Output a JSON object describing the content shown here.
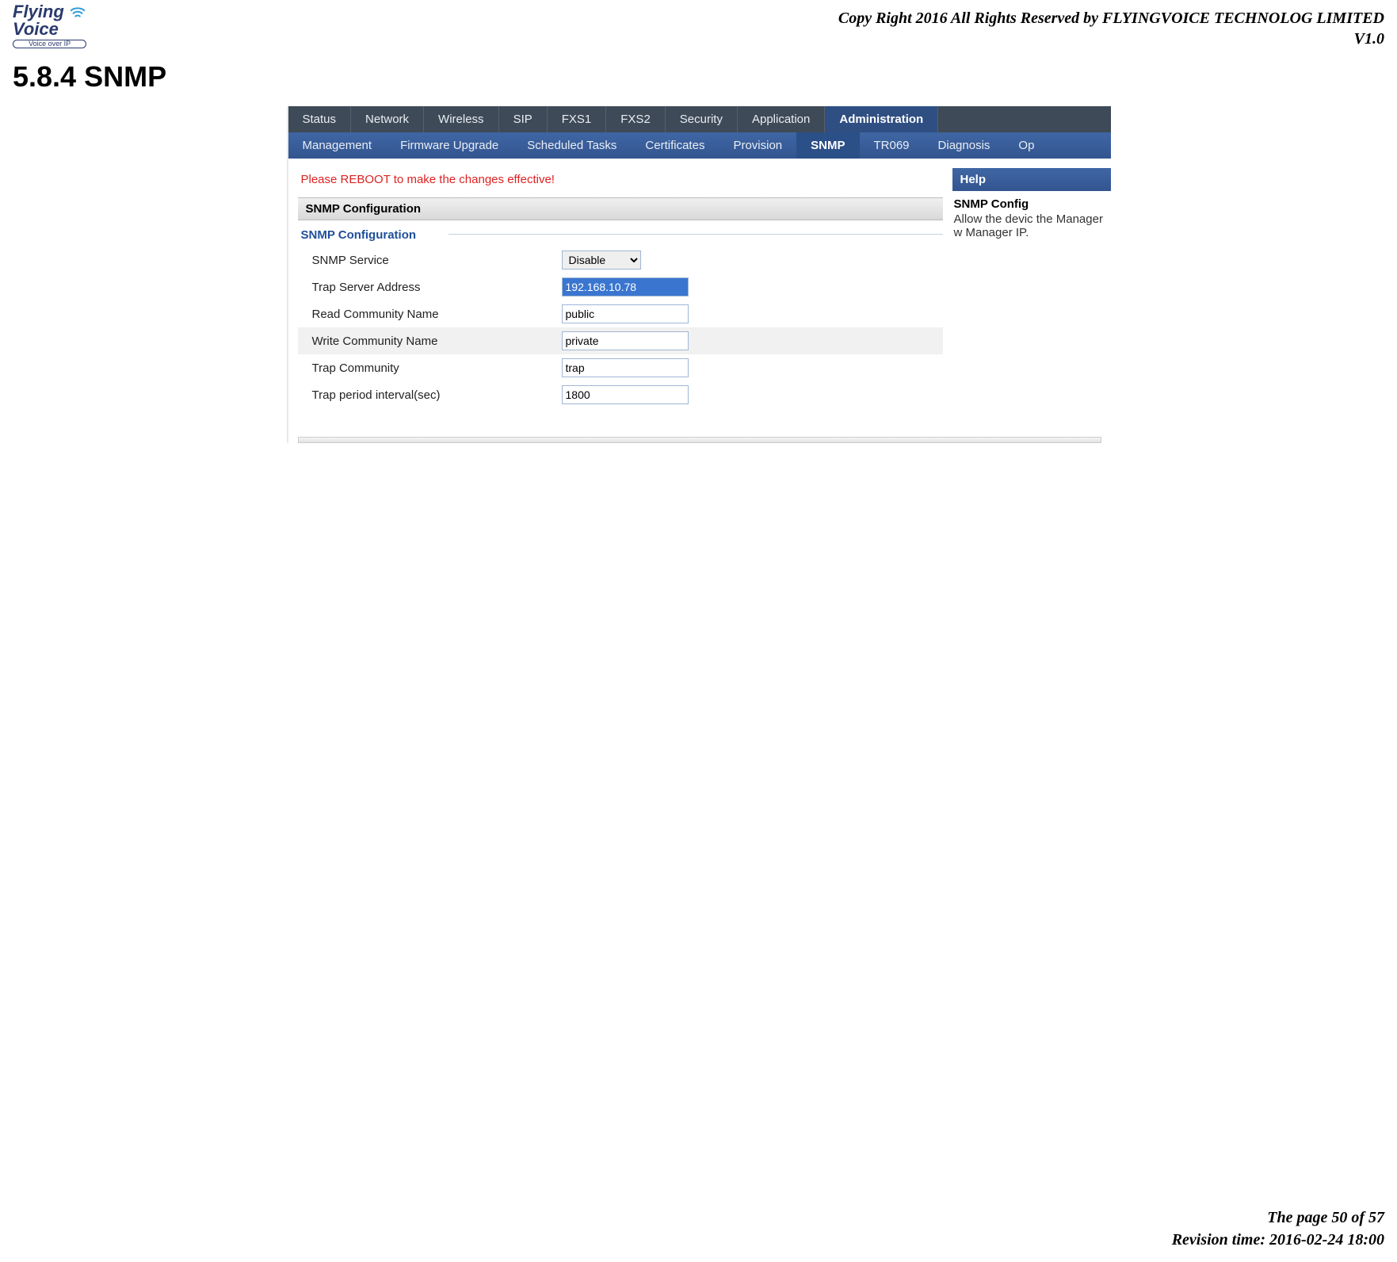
{
  "doc": {
    "copyright": "Copy Right 2016 All Rights Reserved by FLYINGVOICE TECHNOLOG LIMITED",
    "version": "V1.0",
    "section_number_title": "5.8.4 SNMP",
    "page_info": "The page 50 of 57",
    "revision": "Revision time: 2016-02-24 18:00"
  },
  "logo": {
    "line1": "Flying",
    "line2": "Voice",
    "sub": "Voice over IP"
  },
  "main_tabs": [
    "Status",
    "Network",
    "Wireless",
    "SIP",
    "FXS1",
    "FXS2",
    "Security",
    "Application",
    "Administration"
  ],
  "main_tabs_active": 8,
  "sub_tabs": [
    "Management",
    "Firmware Upgrade",
    "Scheduled Tasks",
    "Certificates",
    "Provision",
    "SNMP",
    "TR069",
    "Diagnosis",
    "Op"
  ],
  "sub_tabs_active": 5,
  "reboot_msg": "Please REBOOT to make the changes effective!",
  "panel_title": "SNMP Configuration",
  "fieldset_title": "SNMP Configuration",
  "form": {
    "rows": [
      {
        "label": "SNMP Service",
        "type": "select",
        "value": "Disable"
      },
      {
        "label": "Trap Server Address",
        "type": "text",
        "value": "192.168.10.78",
        "highlight": true
      },
      {
        "label": "Read Community Name",
        "type": "text",
        "value": "public"
      },
      {
        "label": "Write Community Name",
        "type": "text",
        "value": "private",
        "alt": true
      },
      {
        "label": "Trap Community",
        "type": "text",
        "value": "trap"
      },
      {
        "label": "Trap period interval(sec)",
        "type": "text",
        "value": "1800"
      }
    ]
  },
  "help": {
    "header": "Help",
    "title": "SNMP Config",
    "body": "Allow the devic the Manager w Manager IP."
  }
}
